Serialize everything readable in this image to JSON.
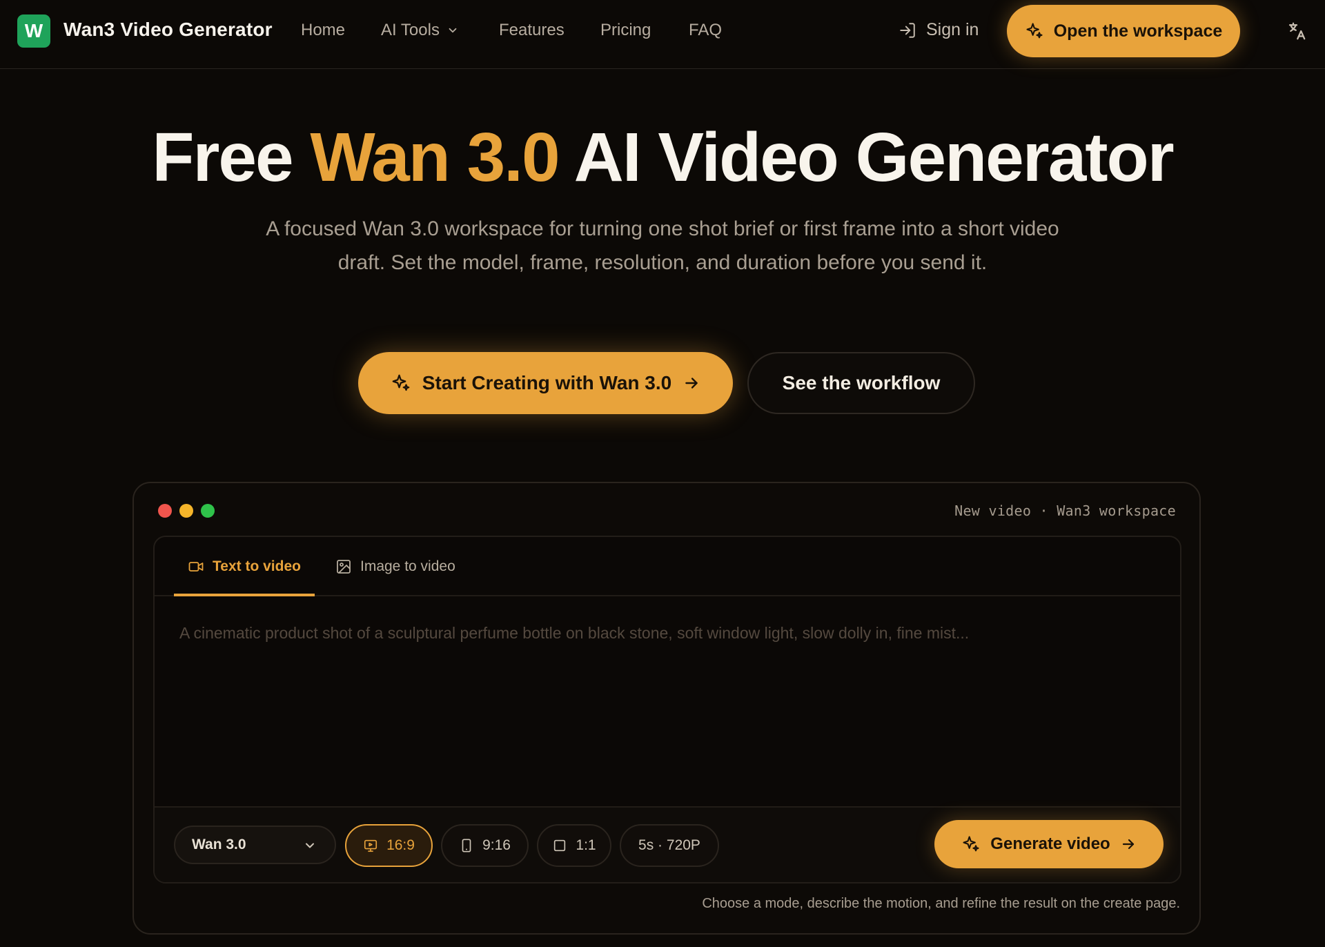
{
  "nav": {
    "logo_letter": "W",
    "brand": "Wan3 Video Generator",
    "links": [
      "Home",
      "AI Tools",
      "Features",
      "Pricing",
      "FAQ"
    ],
    "sign_in": "Sign in",
    "workspace_button": "Open the workspace",
    "icons": {
      "sign_in": "sign-in-icon",
      "workspace": "sparkle-icon",
      "language": "translate-icon",
      "dropdown": "chevron-down-icon"
    }
  },
  "hero": {
    "title_prefix": "Free ",
    "title_accent": "Wan 3.0",
    "title_suffix": " AI Video Generator",
    "subtitle": "A focused Wan 3.0 workspace for turning one shot brief or first frame into a short video draft. Set the model, frame, resolution, and duration before you send it.",
    "cta_primary": "Start Creating with Wan 3.0",
    "cta_secondary": "See the workflow"
  },
  "workspace": {
    "meta": "New video · Wan3 workspace",
    "tabs": [
      {
        "label": "Text to video",
        "icon": "video-camera-icon",
        "active": true
      },
      {
        "label": "Image to video",
        "icon": "image-icon",
        "active": false
      }
    ],
    "prompt_placeholder": "A cinematic product shot of a sculptural perfume bottle on black stone, soft window light, slow dolly in, fine mist...",
    "model": "Wan 3.0",
    "aspect_ratios": [
      {
        "label": "16:9",
        "icon": "monitor-icon",
        "active": true
      },
      {
        "label": "9:16",
        "icon": "phone-icon",
        "active": false
      },
      {
        "label": "1:1",
        "icon": "square-icon",
        "active": false
      }
    ],
    "duration_resolution": "5s · 720P",
    "generate_button": "Generate video",
    "helper": "Choose a mode, describe the motion, and refine the result on the create page."
  },
  "colors": {
    "accent": "#e8a33b",
    "background": "#0c0906",
    "logo_green": "#1fa35a",
    "dot_red": "#f0554d",
    "dot_yellow": "#f5b52a",
    "dot_green": "#2fc24a"
  }
}
